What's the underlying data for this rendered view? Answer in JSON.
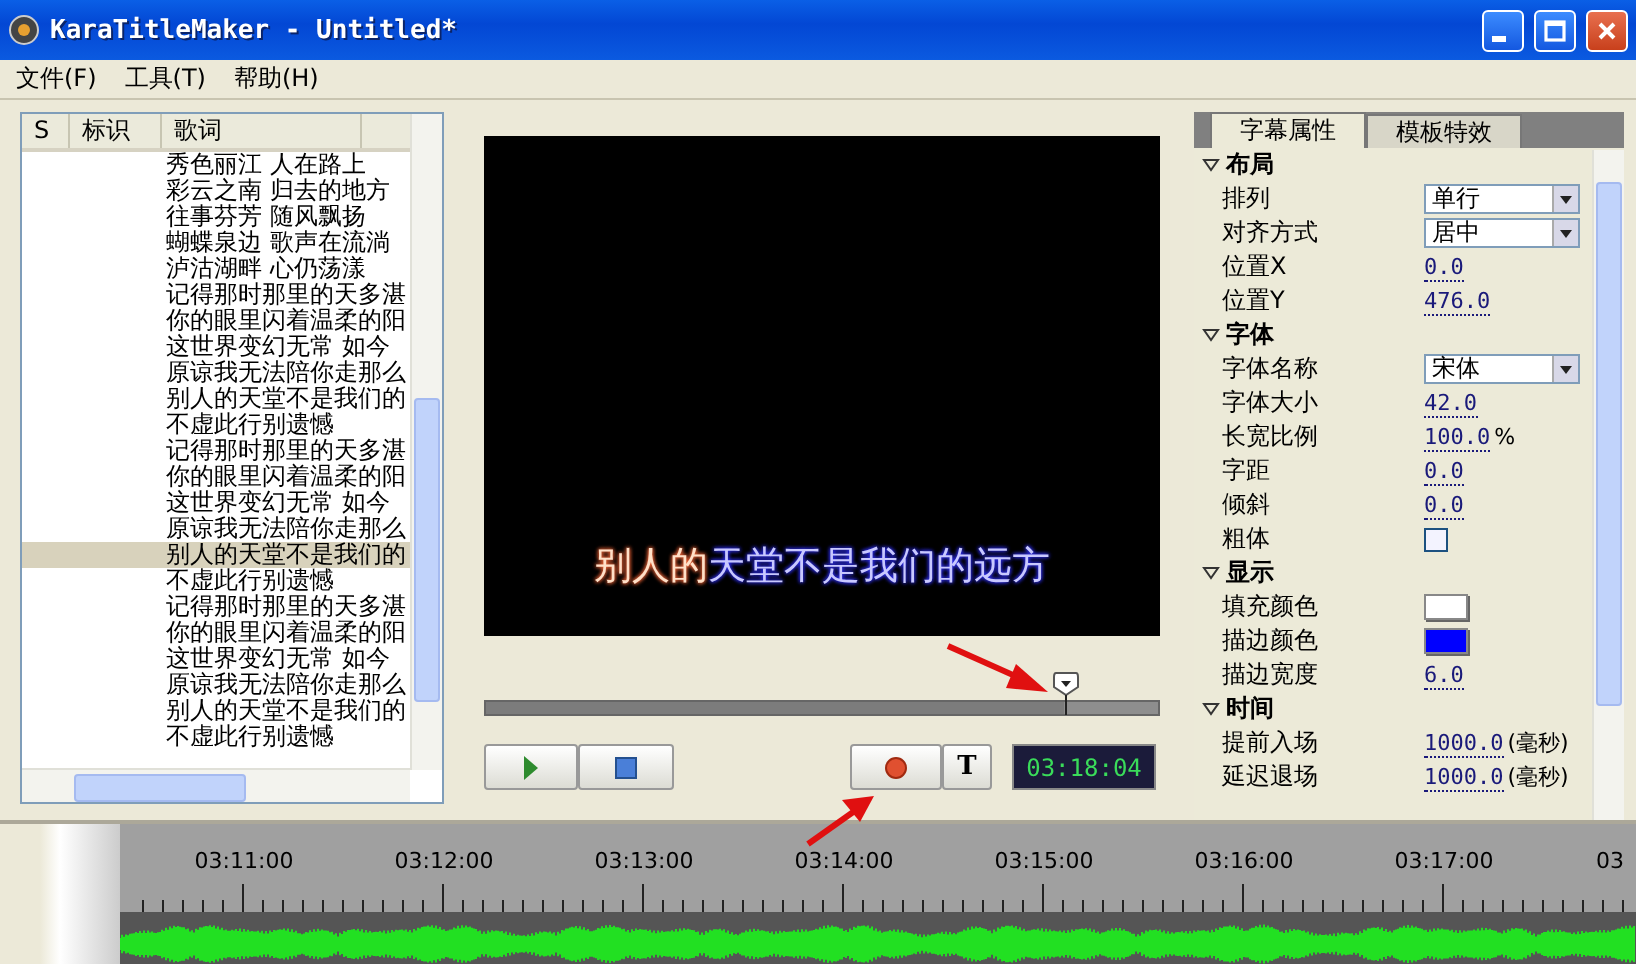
{
  "window": {
    "title": "KaraTitleMaker - Untitled*"
  },
  "menu": [
    "文件(F)",
    "工具(T)",
    "帮助(H)"
  ],
  "lyrics": {
    "columns": [
      "S",
      "标识",
      "歌词"
    ],
    "rows": [
      {
        "text": "秀色丽江 人在路上",
        "selected": false
      },
      {
        "text": "彩云之南 归去的地方",
        "selected": false
      },
      {
        "text": "往事芬芳 随风飘扬",
        "selected": false
      },
      {
        "text": "蝴蝶泉边 歌声在流淌",
        "selected": false
      },
      {
        "text": "泸沽湖畔 心仍荡漾",
        "selected": false
      },
      {
        "text": "记得那时那里的天多湛",
        "selected": false
      },
      {
        "text": "你的眼里闪着温柔的阳",
        "selected": false
      },
      {
        "text": "这世界变幻无常 如今",
        "selected": false
      },
      {
        "text": "原谅我无法陪你走那么",
        "selected": false
      },
      {
        "text": "别人的天堂不是我们的",
        "selected": false
      },
      {
        "text": "不虚此行别遗憾",
        "selected": false
      },
      {
        "text": "记得那时那里的天多湛",
        "selected": false
      },
      {
        "text": "你的眼里闪着温柔的阳",
        "selected": false
      },
      {
        "text": "这世界变幻无常 如今",
        "selected": false
      },
      {
        "text": "原谅我无法陪你走那么",
        "selected": false
      },
      {
        "text": "别人的天堂不是我们的",
        "selected": true
      },
      {
        "text": "不虚此行别遗憾",
        "selected": false
      },
      {
        "text": "记得那时那里的天多湛",
        "selected": false
      },
      {
        "text": "你的眼里闪着温柔的阳",
        "selected": false
      },
      {
        "text": "这世界变幻无常 如今",
        "selected": false
      },
      {
        "text": "原谅我无法陪你走那么",
        "selected": false
      },
      {
        "text": "别人的天堂不是我们的",
        "selected": false
      },
      {
        "text": "不虚此行别遗憾",
        "selected": false
      }
    ]
  },
  "preview": {
    "sung": "别人的",
    "unsung": "天堂不是我们的远方"
  },
  "seek": {
    "level": 0.86
  },
  "transport": {
    "buttons": [
      {
        "kind": "play"
      },
      {
        "kind": "stop"
      },
      {
        "kind": "record"
      },
      {
        "kind": "text",
        "label": "T"
      }
    ],
    "time": "03:18:04"
  },
  "properties": {
    "tabs": [
      {
        "label": "字幕属性",
        "selected": true
      },
      {
        "label": "模板特效",
        "selected": false
      }
    ],
    "groups": [
      {
        "title": "布局",
        "expanded": true,
        "rows": [
          {
            "kind": "dropdown",
            "label": "排列",
            "value": "单行"
          },
          {
            "kind": "dropdown",
            "label": "对齐方式",
            "value": "居中"
          },
          {
            "kind": "number",
            "label": "位置X",
            "value": "0.0"
          },
          {
            "kind": "number",
            "label": "位置Y",
            "value": "476.0"
          }
        ]
      },
      {
        "title": "字体",
        "expanded": true,
        "rows": [
          {
            "kind": "dropdown",
            "label": "字体名称",
            "value": "宋体"
          },
          {
            "kind": "number",
            "label": "字体大小",
            "value": "42.0"
          },
          {
            "kind": "number",
            "label": "长宽比例",
            "value": "100.0",
            "unit": "%"
          },
          {
            "kind": "number",
            "label": "字距",
            "value": "0.0"
          },
          {
            "kind": "number",
            "label": "倾斜",
            "value": "0.0"
          },
          {
            "kind": "checkbox",
            "label": "粗体",
            "checked": false
          }
        ]
      },
      {
        "title": "显示",
        "expanded": true,
        "rows": [
          {
            "kind": "color",
            "label": "填充颜色",
            "color": "#ffffff"
          },
          {
            "kind": "color",
            "label": "描边颜色",
            "color": "#0000ff"
          },
          {
            "kind": "number",
            "label": "描边宽度",
            "value": "6.0"
          }
        ]
      },
      {
        "title": "时间",
        "expanded": true,
        "rows": [
          {
            "kind": "number",
            "label": "提前入场",
            "value": "1000.0",
            "unit": "(毫秒)"
          },
          {
            "kind": "number",
            "label": "延迟退场",
            "value": "1000.0",
            "unit": "(毫秒)"
          }
        ]
      }
    ]
  },
  "timeline": {
    "ticks": [
      "03:11:00",
      "03:12:00",
      "03:13:00",
      "03:14:00",
      "03:15:00",
      "03:16:00",
      "03:17:00",
      "03"
    ]
  }
}
